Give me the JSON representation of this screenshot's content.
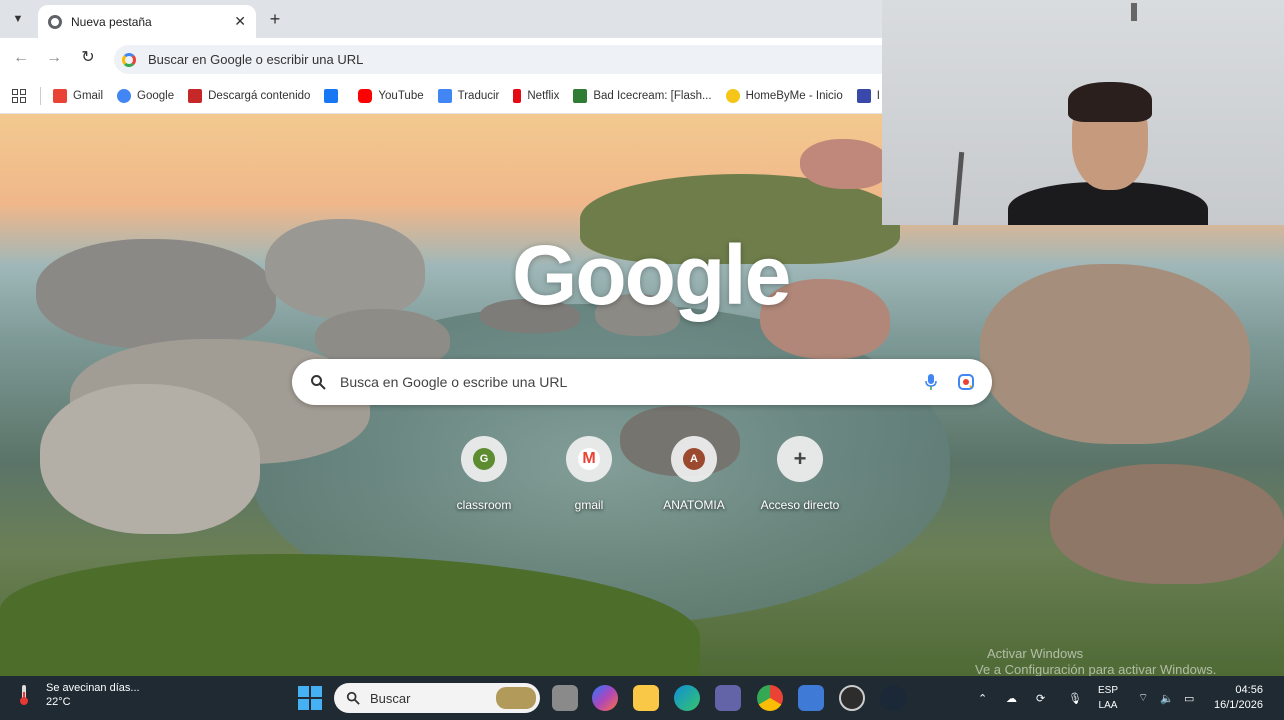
{
  "browser": {
    "tab": {
      "title": "Nueva pestaña"
    },
    "omnibox": {
      "placeholder": "Buscar en Google o escribir una URL"
    },
    "bookmarks": [
      {
        "label": "Gmail",
        "icon": "gmail-icon",
        "color": "#ea4335"
      },
      {
        "label": "Google",
        "icon": "google-icon",
        "color": "#4285f4"
      },
      {
        "label": "Descargá contenido",
        "icon": "download-site-icon",
        "color": "#c62828"
      },
      {
        "label": "",
        "icon": "facebook-icon",
        "color": "#1877f2"
      },
      {
        "label": "YouTube",
        "icon": "youtube-icon",
        "color": "#ff0000"
      },
      {
        "label": "Traducir",
        "icon": "translate-icon",
        "color": "#4285f4"
      },
      {
        "label": "Netflix",
        "icon": "netflix-icon",
        "color": "#e50914"
      },
      {
        "label": "Bad Icecream: [Flash...",
        "icon": "game-icon",
        "color": "#2e7d32"
      },
      {
        "label": "HomeByMe - Inicio",
        "icon": "homebyme-icon",
        "color": "#f5c518"
      },
      {
        "label": "I",
        "icon": "site-icon",
        "color": "#3949ab"
      }
    ]
  },
  "newtab": {
    "logo": "Google",
    "search_placeholder": "Busca en Google o escribe una URL",
    "shortcuts": [
      {
        "label": "classroom",
        "initial": "G",
        "color": "#5e8c31"
      },
      {
        "label": "gmail",
        "initial": "M",
        "color": "#ea4335"
      },
      {
        "label": "ANATOMIA",
        "initial": "A",
        "color": "#9c4a2f"
      },
      {
        "label": "Acceso directo",
        "initial": "+",
        "color": "#444444"
      }
    ],
    "activation_watermark": {
      "line1": "Activar Windows",
      "line2": "Ve a Configuración para activar Windows."
    }
  },
  "taskbar": {
    "weather": {
      "headline": "Se avecinan días...",
      "temp": "22°C"
    },
    "search_placeholder": "Buscar",
    "language": {
      "code": "ESP",
      "layout": "LAA"
    },
    "clock": {
      "time": "04:56",
      "date": "16/1/2026"
    }
  }
}
